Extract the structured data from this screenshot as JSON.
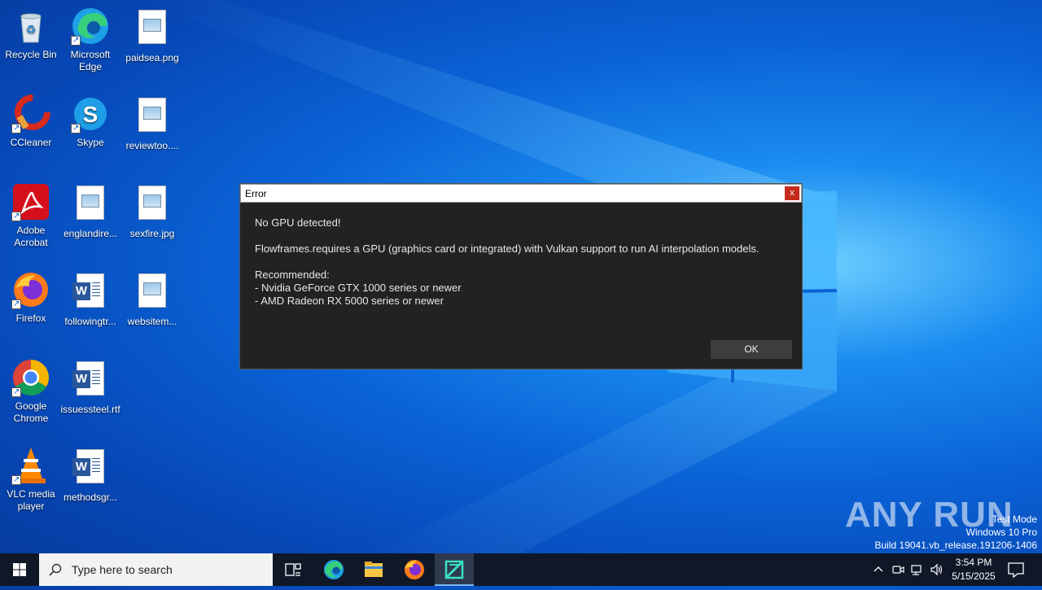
{
  "desktop_icons": [
    {
      "label": "Recycle Bin"
    },
    {
      "label": "Microsoft Edge"
    },
    {
      "label": "paidsea.png"
    },
    {
      "label": "CCleaner"
    },
    {
      "label": "Skype"
    },
    {
      "label": "reviewtoo...."
    },
    {
      "label": "Adobe Acrobat"
    },
    {
      "label": "englandire..."
    },
    {
      "label": "sexfire.jpg"
    },
    {
      "label": "Firefox"
    },
    {
      "label": "followingtr..."
    },
    {
      "label": "websitem..."
    },
    {
      "label": "Google Chrome"
    },
    {
      "label": "issuessteel.rtf"
    },
    {
      "label": "VLC media player"
    },
    {
      "label": "methodsgr..."
    }
  ],
  "dialog": {
    "title": "Error",
    "close_glyph": "x",
    "heading": "No GPU detected!",
    "message": "Flowframes.requires a GPU (graphics card or integrated) with Vulkan support to run AI interpolation models.",
    "recommended_label": "Recommended:",
    "recommendations": [
      "- Nvidia GeForce GTX 1000 series or newer",
      "- AMD Radeon RX 5000 series or newer"
    ],
    "ok_label": "OK"
  },
  "watermark": {
    "brand": "ANY RUN",
    "line1": "Test Mode",
    "line2": "Windows 10 Pro",
    "line3": "Build 19041.vb_release.191206-1406"
  },
  "taskbar": {
    "search_placeholder": "Type here to search",
    "time": "3:54 PM",
    "date": "5/15/2025",
    "pinned": [
      "task-view-icon",
      "edge-icon",
      "file-explorer-icon",
      "firefox-icon",
      "flowframes-icon"
    ]
  },
  "colors": {
    "accent": "#0a63d6",
    "dialog_bg": "#222222",
    "close_red": "#c42b1c"
  }
}
